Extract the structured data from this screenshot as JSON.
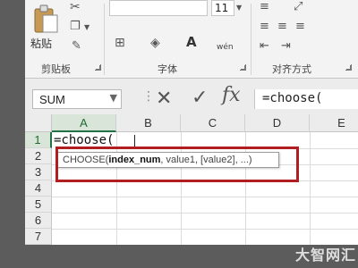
{
  "ribbon": {
    "clipboard": {
      "paste_label": "粘贴",
      "group_label": "剪贴板"
    },
    "font": {
      "group_label": "字体",
      "font_size": "11",
      "wen_label": "wén"
    },
    "alignment": {
      "group_label": "对齐方式"
    }
  },
  "formula_bar": {
    "name_box_value": "SUM",
    "cancel_symbol": "✕",
    "enter_symbol": "✓",
    "fx_label": "fx",
    "formula_value": "=choose("
  },
  "grid": {
    "columns": [
      "A",
      "B",
      "C",
      "D",
      "E"
    ],
    "rows": [
      "1",
      "2",
      "3",
      "4",
      "5",
      "6",
      "7"
    ],
    "active_column": "A",
    "active_row": "1",
    "cell_a1": "=choose("
  },
  "tooltip": {
    "func_name": "CHOOSE(",
    "bold_param": "index_num",
    "rest": ", value1, [value2], ...)"
  },
  "colors": {
    "highlight_box": "#b01e22",
    "active_header": "#217346"
  },
  "watermark": "大智网汇"
}
